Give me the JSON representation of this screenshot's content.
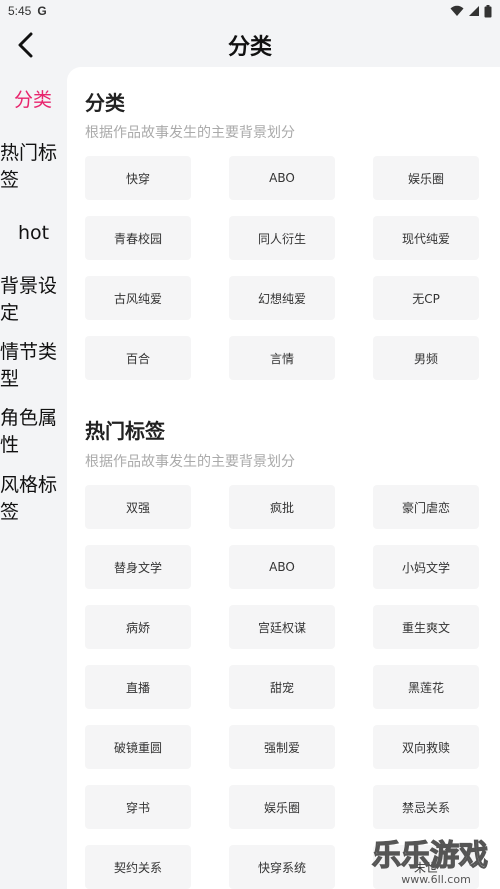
{
  "status": {
    "time": "5:45",
    "g_label": "G"
  },
  "header": {
    "title": "分类"
  },
  "sidebar": {
    "items": [
      {
        "label": "分类",
        "active": true
      },
      {
        "label": "热门标签"
      },
      {
        "label": "hot"
      },
      {
        "label": "背景设定"
      },
      {
        "label": "情节类型"
      },
      {
        "label": "角色属性"
      },
      {
        "label": "风格标签"
      }
    ]
  },
  "sections": [
    {
      "title": "分类",
      "desc": "根据作品故事发生的主要背景划分",
      "tags": [
        "快穿",
        "ABO",
        "娱乐圈",
        "青春校园",
        "同人衍生",
        "现代纯爱",
        "古风纯爱",
        "幻想纯爱",
        "无CP",
        "百合",
        "言情",
        "男频"
      ]
    },
    {
      "title": "热门标签",
      "desc": "根据作品故事发生的主要背景划分",
      "tags": [
        "双强",
        "疯批",
        "豪门虐恋",
        "替身文学",
        "ABO",
        "小妈文学",
        "病娇",
        "宫廷权谋",
        "重生爽文",
        "直播",
        "甜宠",
        "黑莲花",
        "破镜重圆",
        "强制爱",
        "双向救赎",
        "穿书",
        "娱乐圈",
        "禁忌关系",
        "契约关系",
        "快穿系统",
        "末世"
      ]
    }
  ],
  "watermark": {
    "text": "乐乐游戏",
    "url": "www.6ll.com"
  },
  "colors": {
    "accent": "#e8246d",
    "bg": "#f3f4f6",
    "panel": "#ffffff",
    "tag_bg": "#f5f5f6"
  }
}
